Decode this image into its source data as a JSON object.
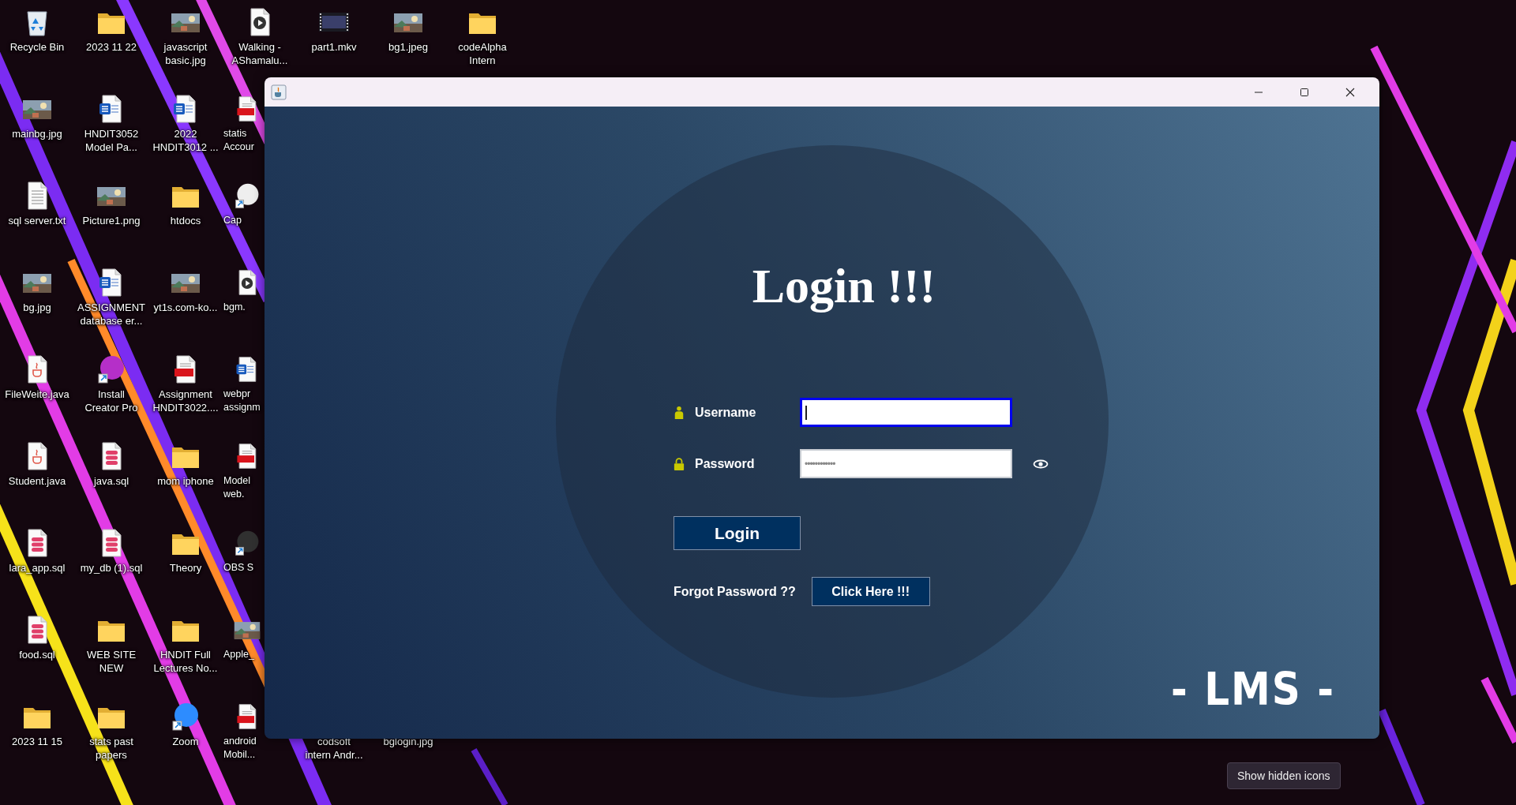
{
  "desktop": {
    "columns": [
      {
        "items": [
          {
            "label": "Recycle Bin",
            "kind": "recycle"
          },
          {
            "label": "mainbg.jpg"
          },
          {
            "label": "sql server.txt",
            "kind": "text"
          },
          {
            "label": "bg.jpg"
          },
          {
            "label": "FileWeite.java",
            "kind": "java"
          },
          {
            "label": "Student.java",
            "kind": "java"
          },
          {
            "label": "lara_app.sql",
            "kind": "sql"
          },
          {
            "label": "food.sql",
            "kind": "sql"
          },
          {
            "label": "2023 11 15",
            "kind": "folder"
          }
        ]
      },
      {
        "items": [
          {
            "label": "2023 11 22",
            "kind": "folder"
          },
          {
            "label": "HNDIT3052\nModel Pa...",
            "kind": "word"
          },
          {
            "label": "Picture1.png"
          },
          {
            "label": "ASSIGNMENT\ndatabase er...",
            "kind": "word"
          },
          {
            "label": "Install\nCreator Pro",
            "kind": "app",
            "color": "#b52fc8"
          },
          {
            "label": "java.sql",
            "kind": "sql"
          },
          {
            "label": "my_db (1).sql",
            "kind": "sql"
          },
          {
            "label": "WEB SITE\nNEW",
            "kind": "folder"
          },
          {
            "label": "stats past\npapers",
            "kind": "folder"
          }
        ]
      },
      {
        "items": [
          {
            "label": "javascript\nbasic.jpg"
          },
          {
            "label": "2022\nHNDIT3012 ...",
            "kind": "word"
          },
          {
            "label": "htdocs",
            "kind": "folder"
          },
          {
            "label": "yt1s.com-ko..."
          },
          {
            "label": "Assignment\nHNDIT3022....",
            "kind": "pdf"
          },
          {
            "label": "mom iphone",
            "kind": "folder"
          },
          {
            "label": "Theory",
            "kind": "folder"
          },
          {
            "label": "HNDIT Full\nLectures No...",
            "kind": "folder"
          },
          {
            "label": "Zoom",
            "kind": "app",
            "color": "#2d8cff"
          }
        ]
      },
      {
        "items": [
          {
            "label": "Walking -\nAShamalu...",
            "kind": "media",
            "covered": false
          },
          {
            "label": "statis\nAccour",
            "kind": "pdf",
            "covered": true
          },
          {
            "label": "Cap",
            "kind": "app",
            "color": "#eeeeee",
            "covered": true
          },
          {
            "label": "bgm.",
            "kind": "media",
            "covered": true
          },
          {
            "label": "webpr\nassignm",
            "kind": "word",
            "covered": true
          },
          {
            "label": "Model\nweb.",
            "kind": "pdf",
            "covered": true
          },
          {
            "label": "OBS S",
            "kind": "app",
            "color": "#303030",
            "covered": true
          },
          {
            "label": "Apple_",
            "covered": true
          },
          {
            "label": "android\nMobil...",
            "kind": "pdf",
            "covered": true
          }
        ]
      },
      {
        "items": [
          {
            "label": "part1.mkv",
            "kind": "film"
          },
          {
            "label": "codsoft\nintern Andr...",
            "kind": "hidden"
          }
        ]
      },
      {
        "items": [
          {
            "label": "bg1.jpeg"
          },
          {
            "label": "bglogin.jpg",
            "kind": "hidden"
          }
        ]
      },
      {
        "items": [
          {
            "label": "codeAlpha\nIntern",
            "kind": "folder"
          }
        ]
      }
    ]
  },
  "window": {
    "form": {
      "heading": "Login !!!",
      "fields": [
        {
          "label": "Username",
          "kind": "user",
          "focused": true
        },
        {
          "label": "Password",
          "kind": "password",
          "focused": false,
          "value": "••••••••••••"
        }
      ],
      "login_button": "Login",
      "forgot_text": "Forgot Password ??",
      "forgot_button": "Click Here !!!"
    },
    "brand": "- LMS -"
  },
  "tooltip": "Show hidden icons"
}
